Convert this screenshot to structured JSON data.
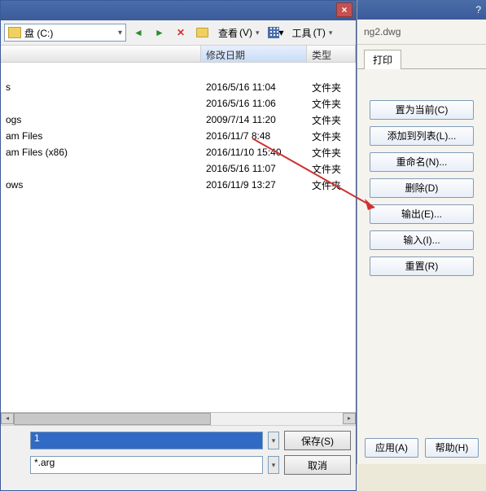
{
  "file_dialog": {
    "path_label": "盘 (C:)",
    "toolbar": {
      "view_label": "查看",
      "tools_label": "工具"
    },
    "header": {
      "name": "",
      "date": "修改日期",
      "type": "类型"
    },
    "rows": [
      {
        "name": "",
        "date": "",
        "type": ""
      },
      {
        "name": "s",
        "date": "2016/5/16 11:04",
        "type": "文件夹"
      },
      {
        "name": "",
        "date": "2016/5/16 11:06",
        "type": "文件夹"
      },
      {
        "name": "ogs",
        "date": "2009/7/14 11:20",
        "type": "文件夹"
      },
      {
        "name": "am Files",
        "date": "2016/11/7 8:48",
        "type": "文件夹"
      },
      {
        "name": "am Files (x86)",
        "date": "2016/11/10 15:40",
        "type": "文件夹"
      },
      {
        "name": "",
        "date": "2016/5/16 11:07",
        "type": "文件夹"
      },
      {
        "name": "ows",
        "date": "2016/11/9 13:27",
        "type": "文件夹"
      }
    ],
    "filename_value": "1",
    "filetype_value": "*.arg",
    "save_label": "保存(S)",
    "cancel_label": "取消",
    "view_hotkey": "(V)",
    "tools_hotkey": "(T)"
  },
  "profile_panel": {
    "help_icon": "?",
    "filename": "ng2.dwg",
    "tab_print": "打印",
    "buttons": {
      "set_current": "置为当前(C)",
      "add_to_list": "添加到列表(L)...",
      "rename": "重命名(N)...",
      "delete": "删除(D)",
      "export": "输出(E)...",
      "import": "输入(I)...",
      "reset": "重置(R)"
    },
    "apply": "应用(A)",
    "help": "帮助(H)"
  }
}
